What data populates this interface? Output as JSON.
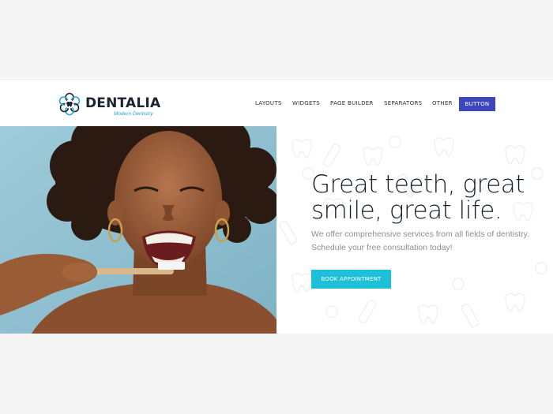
{
  "brand": {
    "name": "DENTALIA",
    "tagline": "Modern Dentistry"
  },
  "nav": {
    "items": [
      "LAYOUTS",
      "WIDGETS",
      "PAGE BUILDER",
      "SEPARATORS",
      "OTHER"
    ],
    "button_label": "BUTTON"
  },
  "hero": {
    "headline_line1": "Great teeth, great",
    "headline_line2": "smile, great life.",
    "subtext": "We offer comprehensive services from all fields of dentistry. Schedule your free consultation today!",
    "cta_label": "BOOK APPOINTMENT",
    "photo_icon": "woman-brushing-teeth-photo"
  },
  "colors": {
    "accent": "#1dbfd9",
    "brand": "#3d47bd",
    "heading": "#15202b",
    "body_text": "#8c8f93"
  }
}
